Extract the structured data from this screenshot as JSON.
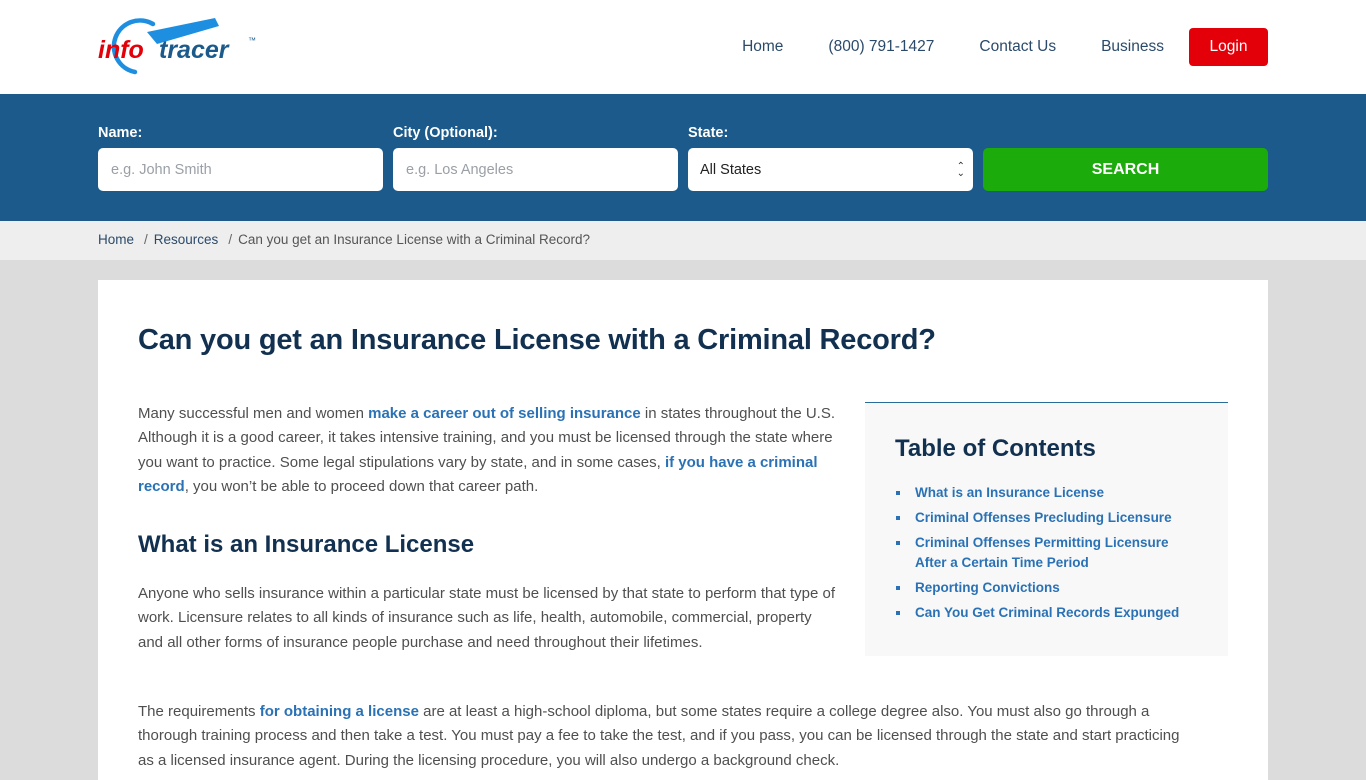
{
  "header": {
    "logo": {
      "part1": "info",
      "part2": "tracer",
      "tm": "™",
      "colors": {
        "info": "#e40009",
        "tracer": "#1b5a8a",
        "lens": "#1e8fe0"
      }
    },
    "nav": [
      {
        "label": "Home"
      },
      {
        "label": "(800) 791-1427"
      },
      {
        "label": "Contact Us"
      },
      {
        "label": "Business"
      }
    ],
    "login_label": "Login"
  },
  "search": {
    "name_label": "Name:",
    "name_placeholder": "e.g. John Smith",
    "name_value": "",
    "city_label": "City (Optional):",
    "city_placeholder": "e.g. Los Angeles",
    "city_value": "",
    "state_label": "State:",
    "state_selected": "All States",
    "button_label": "SEARCH"
  },
  "breadcrumb": {
    "items": [
      {
        "label": "Home"
      },
      {
        "label": "Resources"
      }
    ],
    "separator": "/",
    "current": "Can you get an Insurance License with a Criminal Record?"
  },
  "article": {
    "title": "Can you get an Insurance License with a Criminal Record?",
    "intro": {
      "t1": "Many successful men and women ",
      "link1": "make a career out of selling insurance",
      "t2": " in states throughout the U.S. Although it is a good career, it takes intensive training, and you must be licensed through the state where you want to practice. Some legal stipulations vary by state, and in some cases, ",
      "link2": "if you have a criminal record",
      "t3": ", you won’t be able to proceed down that career path."
    },
    "section1_heading": "What is an Insurance License",
    "section1_para": "Anyone who sells insurance within a particular state must be licensed by that state to perform that type of work. Licensure relates to all kinds of insurance such as life, health, automobile, commercial, property and all other forms of insurance people purchase and need throughout their lifetimes.",
    "section1_para2": {
      "t1": "The requirements ",
      "link1": "for obtaining a license",
      "t2": " are at least a high-school diploma, but some states require a college degree also. You must also go through a thorough training process and then take a test. You must pay a fee to take the test, and if you pass, you can be licensed through the state and start practicing as a licensed insurance agent. During the licensing procedure, you will also undergo a background check."
    }
  },
  "toc": {
    "title": "Table of Contents",
    "items": [
      {
        "label": "What is an Insurance License"
      },
      {
        "label": "Criminal Offenses Precluding Licensure"
      },
      {
        "label": "Criminal Offenses Permitting Licensure After a Certain Time Period"
      },
      {
        "label": "Reporting Convictions"
      },
      {
        "label": "Can You Get Criminal Records Expunged"
      }
    ]
  },
  "colors": {
    "brand_blue": "#1b5a8a",
    "login_red": "#e40009",
    "search_green": "#1bab0b",
    "link_blue": "#2a72b5",
    "heading_navy": "#12304f"
  }
}
